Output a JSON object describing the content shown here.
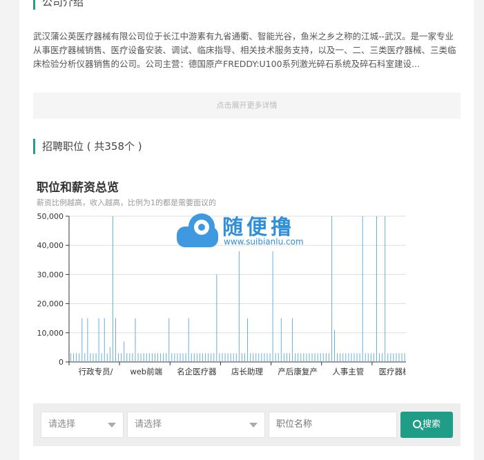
{
  "company_section": {
    "heading": "公司介绍",
    "description": "武汉蒲公英医疗器械有限公司位于长江中游素有九省通衢、智能光谷，鱼米之乡之称的江城--武汉。是一家专业从事医疗器械销售、医疗设备安装、调试、临床指导、相关技术服务支持，以及一、二、三类医疗器械、三类临床检验分析仪器销售的公司。公司主营：德国原产FREDDY:U100系列激光碎石系统及碎石科室建设...",
    "expand_label": "点击展开更多详情"
  },
  "jobs_section": {
    "heading": "招聘职位 ( 共358个 )"
  },
  "chart_data": {
    "type": "bar",
    "title": "职位和薪资总览",
    "subtitle": "薪资比例越高，收入越高，比例为1的都是需要面议的",
    "xlabel": "",
    "ylabel": "",
    "ylim": [
      0,
      50000
    ],
    "yticks": [
      "0",
      "10,000",
      "20,000",
      "30,000",
      "40,000",
      "50,000"
    ],
    "x_tick_labels": [
      "行政专员/",
      "web前端",
      "名企医疗器",
      "店长助理",
      "产后康复产",
      "人事主管",
      "医疗器械研"
    ],
    "bar_color": "#6aaed6",
    "grid": true,
    "values": [
      3000,
      3000,
      3000,
      3000,
      15000,
      3000,
      15000,
      3000,
      3000,
      3000,
      15000,
      3000,
      15000,
      3000,
      5000,
      50000,
      15000,
      3000,
      3000,
      7000,
      3000,
      3000,
      3000,
      15000,
      3000,
      3000,
      3000,
      3000,
      3000,
      3000,
      3000,
      3000,
      3000,
      3000,
      3000,
      15000,
      3000,
      3000,
      3000,
      3000,
      3000,
      3000,
      15000,
      3000,
      3000,
      3000,
      3000,
      3000,
      3000,
      3000,
      3000,
      3000,
      30000,
      3000,
      3000,
      3000,
      3000,
      3000,
      3000,
      3000,
      38000,
      3000,
      3000,
      15000,
      3000,
      3000,
      3000,
      3000,
      3000,
      3000,
      3000,
      3000,
      38000,
      3000,
      3000,
      15000,
      3000,
      3000,
      3000,
      15000,
      3000,
      3000,
      3000,
      3000,
      3000,
      3000,
      3000,
      3000,
      3000,
      3000,
      3000,
      3000,
      3000,
      50000,
      11000,
      3000,
      3000,
      3000,
      3000,
      3000,
      3000,
      3000,
      3000,
      3000,
      50000,
      3000,
      3000,
      3000,
      3000,
      50000,
      3000,
      3000,
      50000,
      3000,
      3000,
      3000,
      3000,
      3000,
      3000,
      3000,
      3000,
      3000,
      3000,
      3000,
      15000
    ]
  },
  "watermark": {
    "text": "随便撸",
    "url": "www.suibianlu.com"
  },
  "search_bar": {
    "select_1": "请选择",
    "select_2": "请选择",
    "keyword_placeholder": "职位名称",
    "search_label": "搜索"
  }
}
